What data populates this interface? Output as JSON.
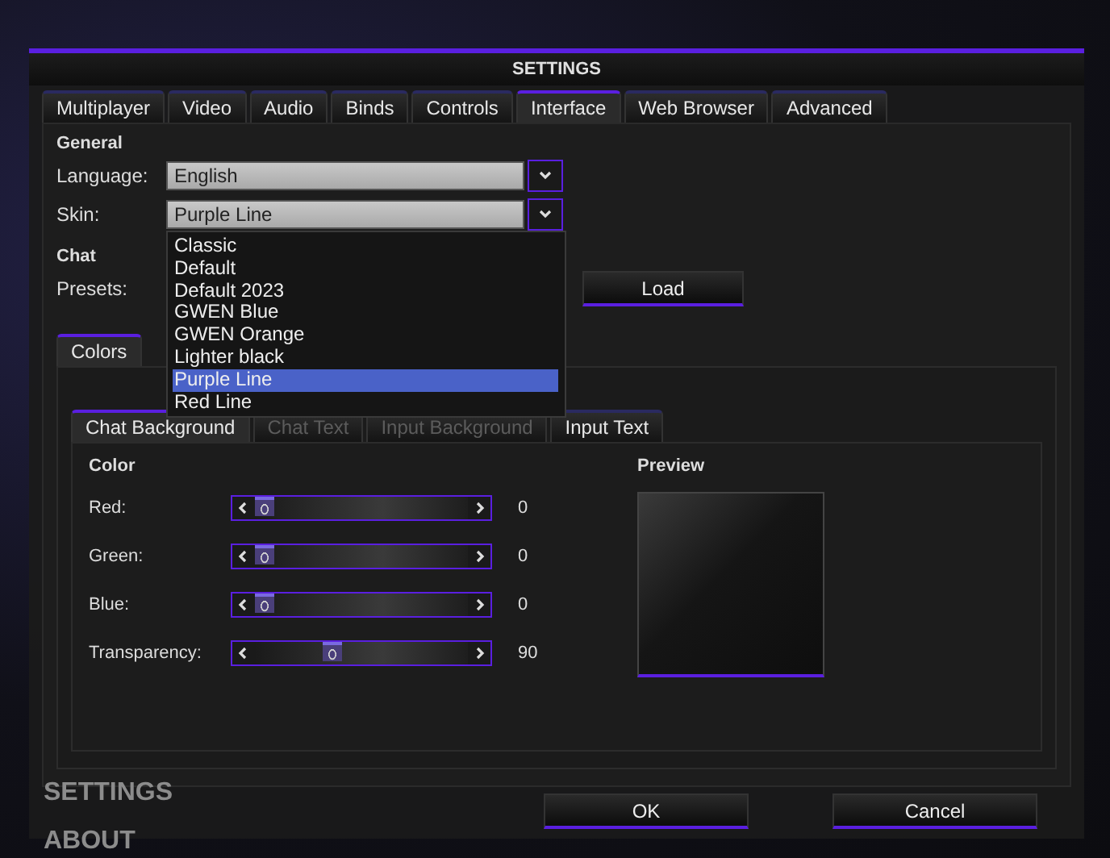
{
  "window": {
    "title": "SETTINGS"
  },
  "tabs": [
    {
      "label": "Multiplayer",
      "selected": false
    },
    {
      "label": "Video",
      "selected": false
    },
    {
      "label": "Audio",
      "selected": false
    },
    {
      "label": "Binds",
      "selected": false
    },
    {
      "label": "Controls",
      "selected": false
    },
    {
      "label": "Interface",
      "selected": true
    },
    {
      "label": "Web Browser",
      "selected": false
    },
    {
      "label": "Advanced",
      "selected": false
    }
  ],
  "general": {
    "heading": "General",
    "language": {
      "label": "Language:",
      "value": "English"
    },
    "skin": {
      "label": "Skin:",
      "value": "Purple Line",
      "expanded": true,
      "options": [
        {
          "label": "Classic",
          "selected": false
        },
        {
          "label": "Default",
          "selected": false
        },
        {
          "label": "Default 2023",
          "selected": false
        },
        {
          "label": "GWEN Blue",
          "selected": false
        },
        {
          "label": "GWEN Orange",
          "selected": false
        },
        {
          "label": "Lighter black",
          "selected": false
        },
        {
          "label": "Purple Line",
          "selected": true
        },
        {
          "label": "Red Line",
          "selected": false
        }
      ]
    }
  },
  "chat": {
    "heading": "Chat",
    "presets": {
      "label": "Presets:"
    },
    "load_button": "Load"
  },
  "subtabs": [
    {
      "label": "Colors",
      "selected": true
    }
  ],
  "color_tabs": [
    {
      "label": "Chat Background",
      "selected": true,
      "disabled": false
    },
    {
      "label": "Chat Text",
      "selected": false,
      "disabled": true
    },
    {
      "label": "Input Background",
      "selected": false,
      "disabled": true
    },
    {
      "label": "Input Text",
      "selected": false,
      "disabled": false
    }
  ],
  "color": {
    "heading": "Color",
    "sliders": [
      {
        "label": "Red:",
        "level": 0,
        "reading": "0"
      },
      {
        "label": "Green:",
        "level": 0,
        "reading": "0"
      },
      {
        "label": "Blue:",
        "level": 0,
        "reading": "0"
      },
      {
        "label": "Transparency:",
        "level": 0.35,
        "reading": "90"
      }
    ]
  },
  "preview": {
    "heading": "Preview"
  },
  "buttons": [
    "OK",
    "Cancel"
  ],
  "background_menu": [
    "SETTINGS",
    "ABOUT"
  ]
}
